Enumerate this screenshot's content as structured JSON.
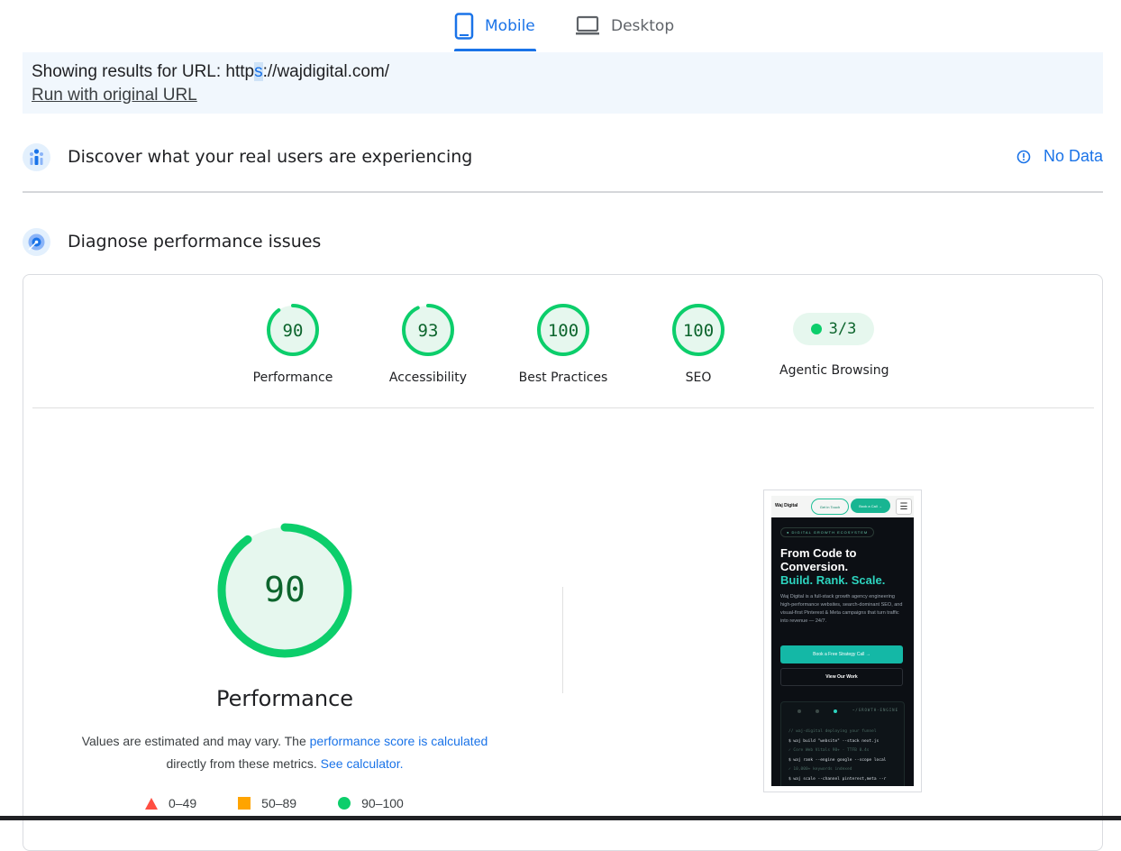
{
  "tabs": {
    "mobile": "Mobile",
    "desktop": "Desktop"
  },
  "url_notice": {
    "prefix": "Showing results for URL: http",
    "highlight": "s",
    "suffix": "://wajdigital.com/",
    "run_link": "Run with original URL"
  },
  "crux": {
    "title": "Discover what your real users are experiencing",
    "no_data": "No Data"
  },
  "diagnose": {
    "title": "Diagnose performance issues"
  },
  "scores": [
    {
      "label": "Performance",
      "value": "90"
    },
    {
      "label": "Accessibility",
      "value": "93"
    },
    {
      "label": "Best Practices",
      "value": "100"
    },
    {
      "label": "SEO",
      "value": "100"
    }
  ],
  "agentic": {
    "label": "Agentic Browsing",
    "value": "3/3"
  },
  "main_gauge": {
    "value": "90",
    "label": "Performance"
  },
  "note": {
    "text1": "Values are estimated and may vary. The ",
    "link1": "performance score is calculated",
    "text2": "directly from these metrics.",
    "link2": "See calculator."
  },
  "legend": {
    "fail": "0–49",
    "average": "50–89",
    "pass": "90–100"
  },
  "colors": {
    "pass": "#0cce6b",
    "pass_text": "#0d652d",
    "average": "#ffa400",
    "fail": "#ff4e42",
    "accent": "#1a73e8"
  },
  "thumbnail": {
    "logo": "Waj Digital",
    "btn_touch": "Get in Touch",
    "btn_call": "Book a Call →",
    "menu": "☰",
    "badge": "● DIGITAL GROWTH ECOSYSTEM",
    "h1_line1": "From Code to",
    "h1_line2": "Conversion.",
    "h2": "Build. Rank. Scale.",
    "para": "Waj Digital is a full-stack growth agency engineering high-performance websites, search-dominant SEO, and visual-first Pinterest & Meta campaigns that turn traffic into revenue — 24/7.",
    "cta": "Book a Free Strategy Call →",
    "cta2": "View Our Work",
    "term_tag": "~/GROWTH-ENGINE",
    "term_lines": [
      "// waj-digital deploying your funnel",
      "$ waj build \"website\" --stack next.js",
      "✓ Core Web Vitals 90+ · TTFB 0.4s",
      "$ waj rank --engine google --scope local",
      "✓ 10,000+ keywords indexed",
      "$ waj scale --channel pinterest,meta --r"
    ]
  }
}
